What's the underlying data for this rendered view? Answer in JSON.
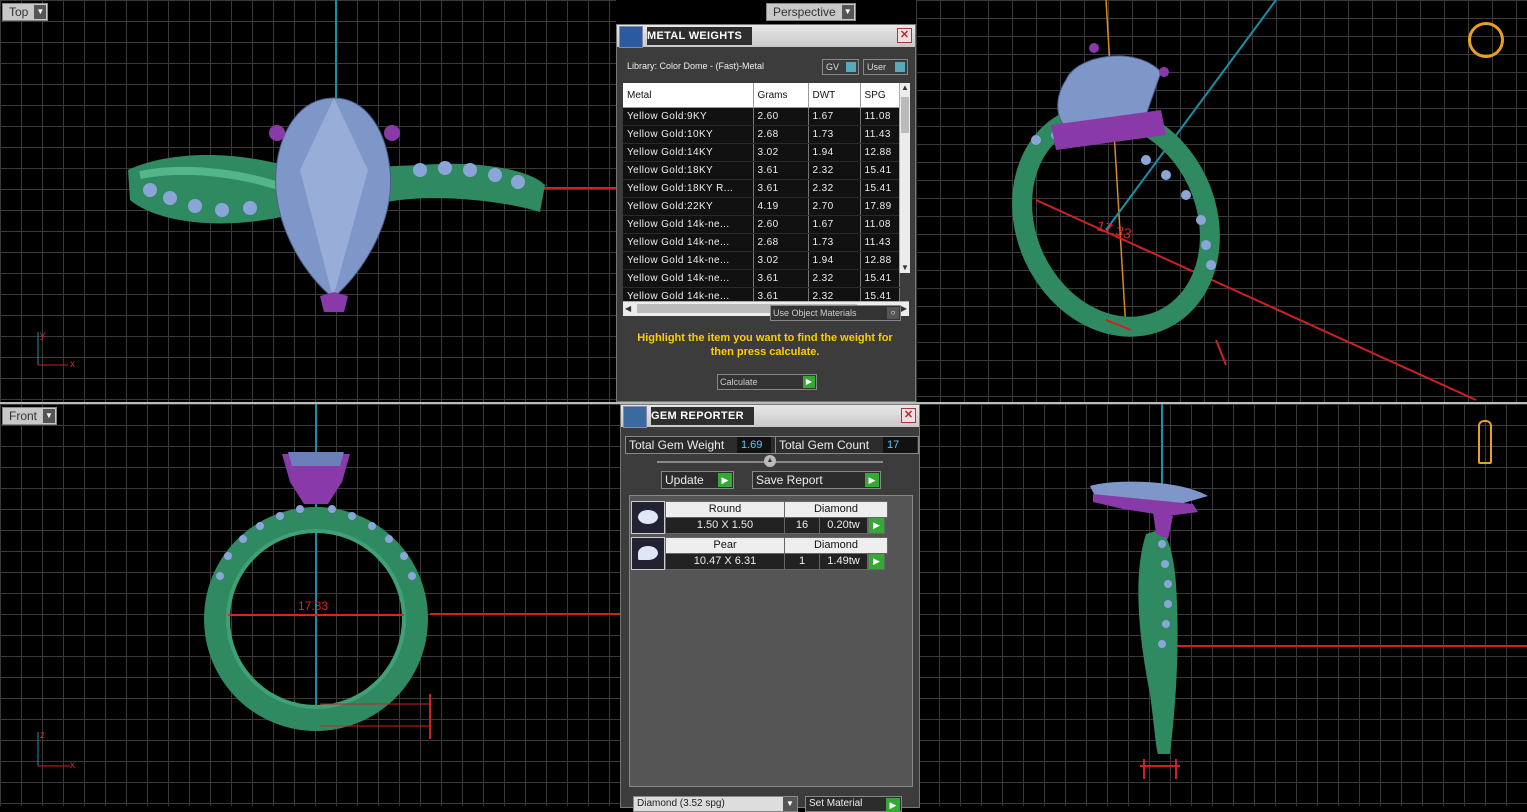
{
  "viewports": {
    "top": {
      "label": "Top"
    },
    "perspective": {
      "label": "Perspective"
    },
    "front": {
      "label": "Front"
    }
  },
  "dimensions": {
    "front_width": "17.33",
    "perspective_width": "17.33"
  },
  "axes": {
    "x": "x",
    "y": "y",
    "z": "z"
  },
  "metal_weights": {
    "title": "METAL WEIGHTS",
    "library": "Library: Color Dome - (Fast)-Metal",
    "gv_label": "GV",
    "user_label": "User",
    "columns": [
      "Metal",
      "Grams",
      "DWT",
      "SPG"
    ],
    "rows": [
      {
        "metal": "Yellow Gold:9KY",
        "grams": "2.60",
        "dwt": "1.67",
        "spg": "11.08"
      },
      {
        "metal": "Yellow Gold:10KY",
        "grams": "2.68",
        "dwt": "1.73",
        "spg": "11.43"
      },
      {
        "metal": "Yellow Gold:14KY",
        "grams": "3.02",
        "dwt": "1.94",
        "spg": "12.88"
      },
      {
        "metal": "Yellow Gold:18KY",
        "grams": "3.61",
        "dwt": "2.32",
        "spg": "15.41"
      },
      {
        "metal": "Yellow Gold:18KY R...",
        "grams": "3.61",
        "dwt": "2.32",
        "spg": "15.41"
      },
      {
        "metal": "Yellow Gold:22KY",
        "grams": "4.19",
        "dwt": "2.70",
        "spg": "17.89"
      },
      {
        "metal": "Yellow Gold 14k-ne...",
        "grams": "2.60",
        "dwt": "1.67",
        "spg": "11.08"
      },
      {
        "metal": "Yellow Gold 14k-ne...",
        "grams": "2.68",
        "dwt": "1.73",
        "spg": "11.43"
      },
      {
        "metal": "Yellow Gold 14k-ne...",
        "grams": "3.02",
        "dwt": "1.94",
        "spg": "12.88"
      },
      {
        "metal": "Yellow Gold 14k-ne...",
        "grams": "3.61",
        "dwt": "2.32",
        "spg": "15.41"
      },
      {
        "metal": "Yellow Gold 14k-ne...",
        "grams": "3.61",
        "dwt": "2.32",
        "spg": "15.41"
      }
    ],
    "use_object_materials": "Use Object Materials",
    "instruction": "Highlight the item you want to find the weight for then press calculate.",
    "calculate": "Calculate"
  },
  "gem_reporter": {
    "title": "GEM REPORTER",
    "total_weight_label": "Total Gem Weight",
    "total_weight": "1.69",
    "total_count_label": "Total Gem Count",
    "total_count": "17",
    "update": "Update",
    "save_report": "Save Report",
    "gems": [
      {
        "shape": "Round",
        "material": "Diamond",
        "size": "1.50 X 1.50",
        "count": "16",
        "weight": "0.20tw"
      },
      {
        "shape": "Pear",
        "material": "Diamond",
        "size": "10.47 X 6.31",
        "count": "1",
        "weight": "1.49tw"
      }
    ],
    "material_select": "Diamond     (3.52 spg)",
    "set_material": "Set Material"
  }
}
